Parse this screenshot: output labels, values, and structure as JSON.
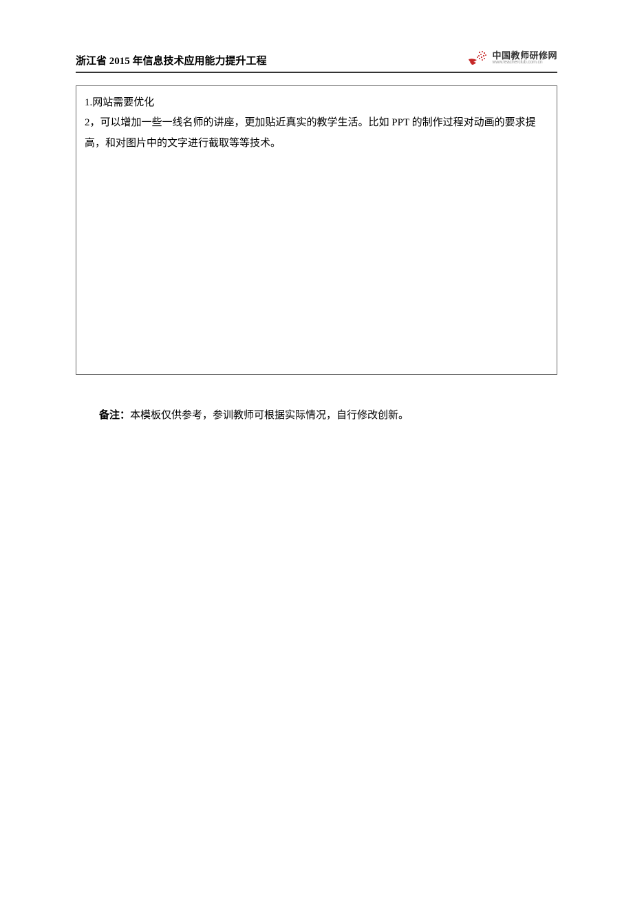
{
  "header": {
    "title": "浙江省 2015 年信息技术应用能力提升工程",
    "logo": {
      "main": "中国教师研修网",
      "sub": "www.teacherclub.com.cn"
    }
  },
  "content": {
    "line1": "1.网站需要优化",
    "line2": "2，可以增加一些一线名师的讲座，更加贴近真实的教学生活。比如 PPT 的制作过程对动画的要求提高，和对图片中的文字进行截取等等技术。"
  },
  "note": {
    "label": "备注：",
    "text": "本模板仅供参考，参训教师可根据实际情况，自行修改创新。"
  }
}
